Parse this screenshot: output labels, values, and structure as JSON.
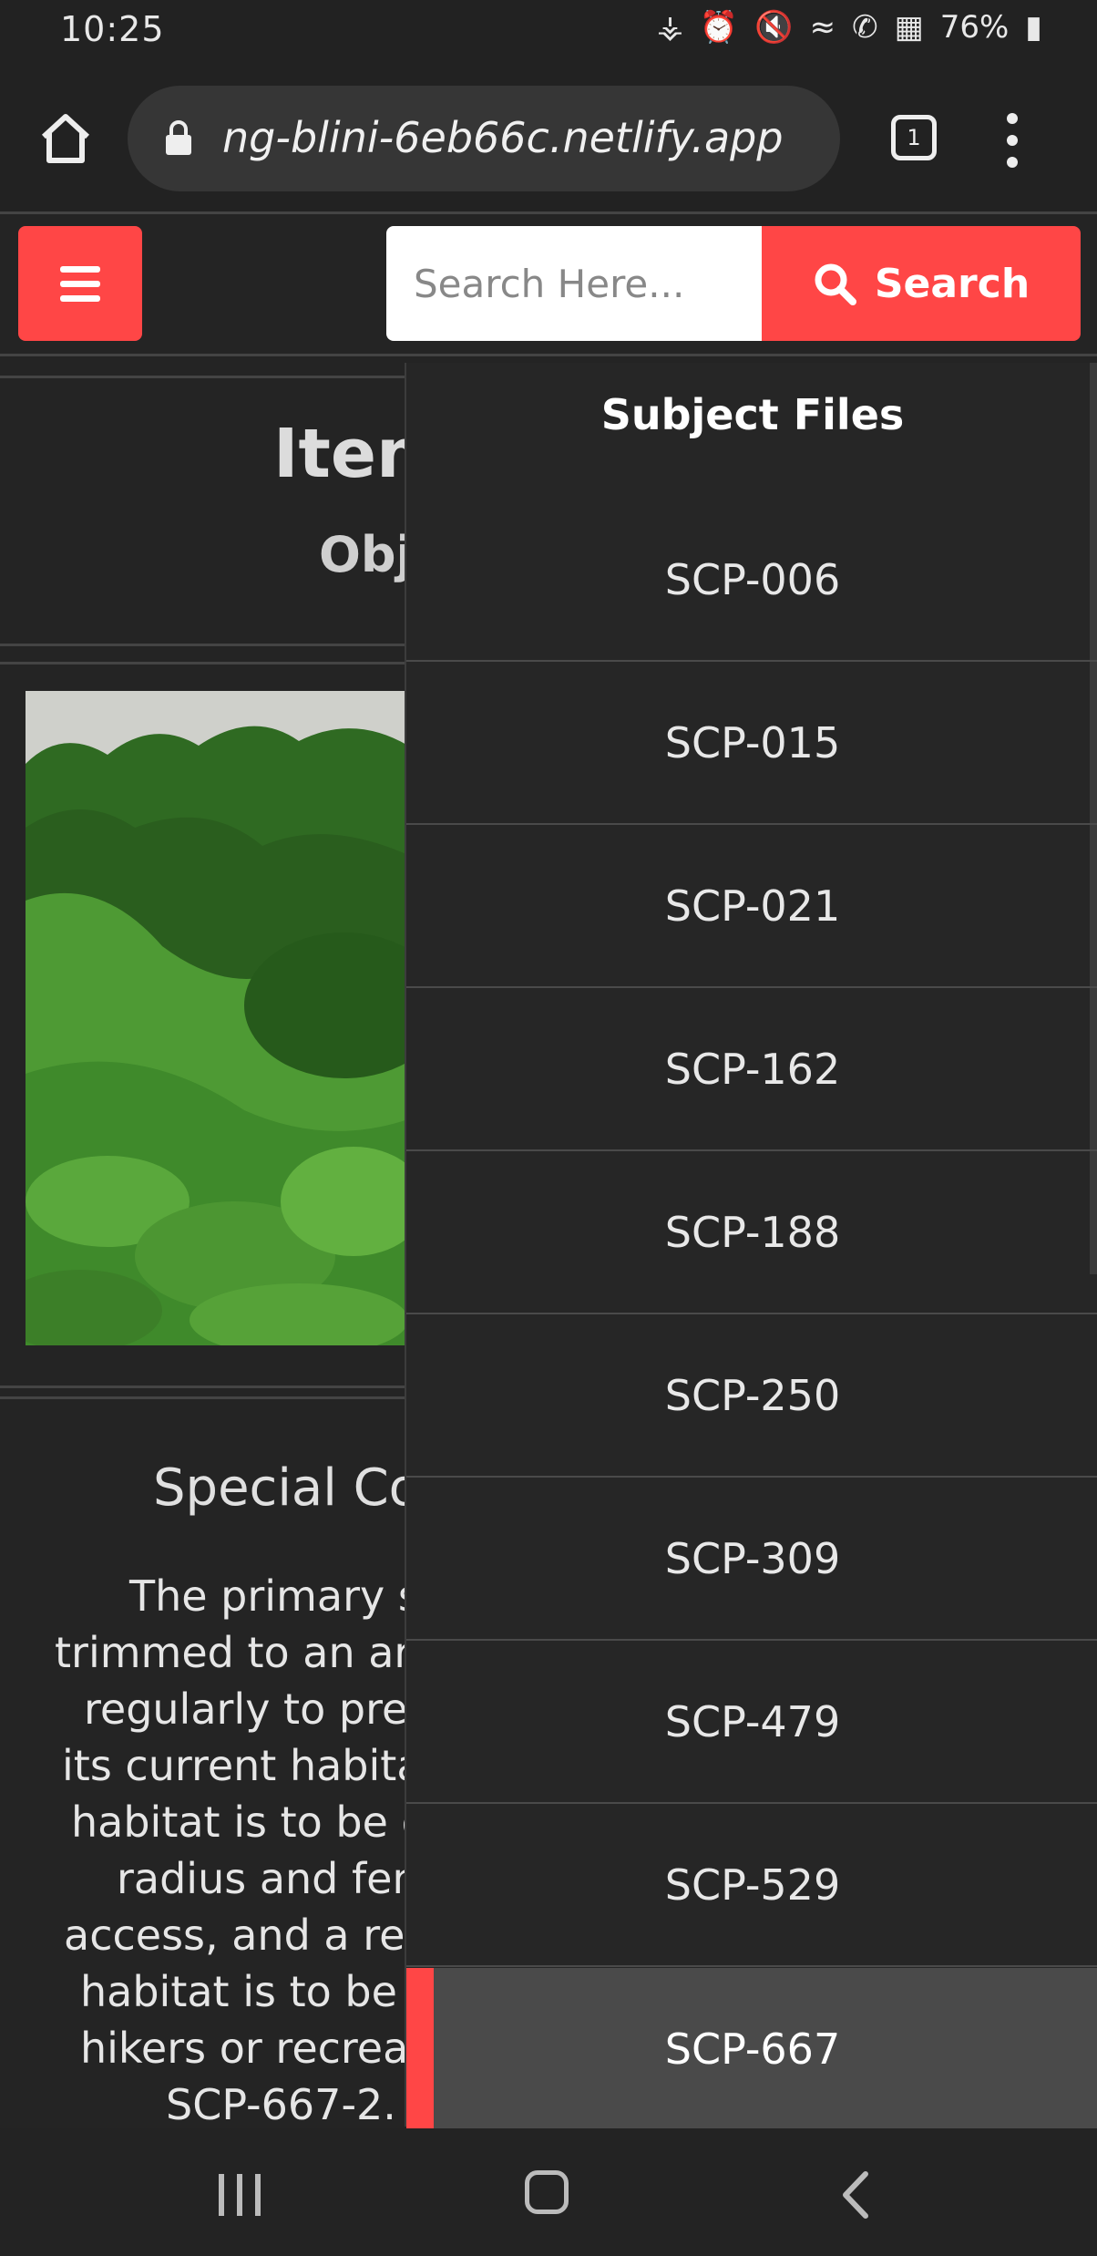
{
  "status_bar": {
    "time": "10:25",
    "battery": "76%"
  },
  "browser": {
    "url": "ng-blini-6eb66c.netlify.app",
    "tab_count": "1"
  },
  "header": {
    "search_placeholder": "Search Here...",
    "search_button_label": "Search",
    "accent_color": "#ff4646"
  },
  "page": {
    "item_title": "Item",
    "object_class": "Obj",
    "special_heading": "Special Co",
    "paragraph_lines": [
      "The primary s",
      "trimmed to an ar",
      "regularly to prev",
      "its current habita",
      "habitat is to be c",
      "radius and fen",
      "access, and a reg",
      "habitat is to be",
      "hikers or recreat",
      "SCP-667-2. "
    ]
  },
  "drawer": {
    "title": "Subject Files",
    "items": [
      "SCP-006",
      "SCP-015",
      "SCP-021",
      "SCP-162",
      "SCP-188",
      "SCP-250",
      "SCP-309",
      "SCP-479",
      "SCP-529",
      "SCP-667"
    ],
    "active_item": "SCP-667"
  }
}
